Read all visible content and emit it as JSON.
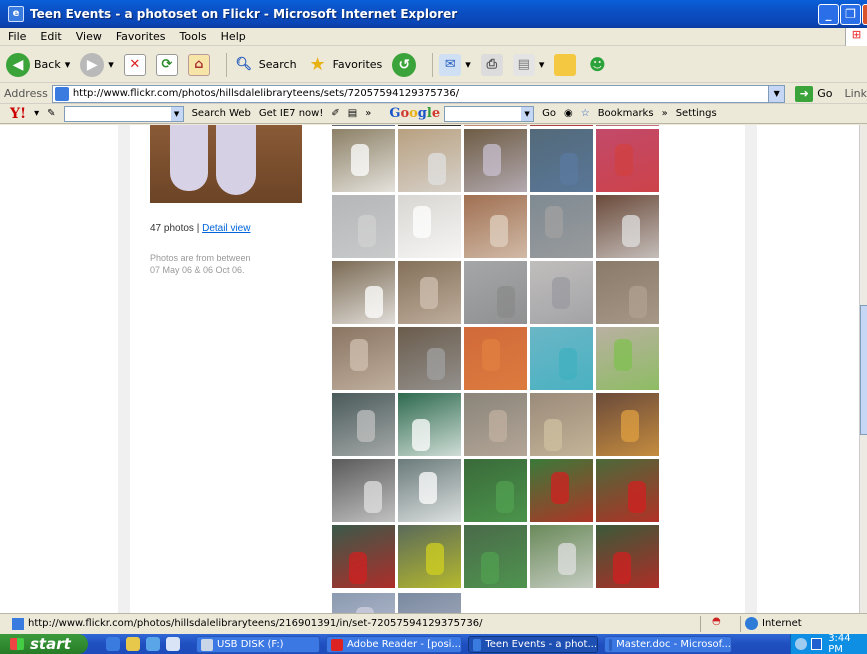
{
  "window": {
    "title": "Teen Events - a photoset on Flickr - Microsoft Internet Explorer",
    "min_glyph": "_",
    "max_glyph": "❐",
    "close_glyph": "X"
  },
  "menu": [
    "File",
    "Edit",
    "View",
    "Favorites",
    "Tools",
    "Help"
  ],
  "toolbar": {
    "back_label": "Back",
    "search_label": "Search",
    "favorites_label": "Favorites"
  },
  "address": {
    "label": "Address",
    "url": "http://www.flickr.com/photos/hillsdalelibraryteens/sets/72057594129375736/",
    "go_label": "Go",
    "links_label": "Link"
  },
  "yahoo_bar": {
    "logo": "Y!",
    "search_web": "Search Web",
    "get_ie7": "Get IE7 now!",
    "google_text": "Google",
    "google_go": "Go",
    "bookmarks": "Bookmarks",
    "settings": "Settings"
  },
  "set_info": {
    "count_text": "47 photos | ",
    "detail_link": "Detail view",
    "range_line1": "Photos are from between",
    "range_line2": "07 May 06 & 06 Oct 06."
  },
  "status": {
    "url": "http://www.flickr.com/photos/hillsdalelibraryteens/216901391/in/set-72057594129375736/",
    "zone": "Internet"
  },
  "taskbar": {
    "start": "start",
    "tasks": [
      {
        "label": "USB DISK (F:)"
      },
      {
        "label": "Adobe Reader - [posi..."
      },
      {
        "label": "Teen Events - a phot..."
      },
      {
        "label": "Master.doc - Microsof..."
      }
    ],
    "clock": "3:44 PM"
  },
  "colors": {
    "xp_blue": "#0a5fd8",
    "flickr_link": "#0063dc",
    "start_green": "#3c9a3c"
  }
}
